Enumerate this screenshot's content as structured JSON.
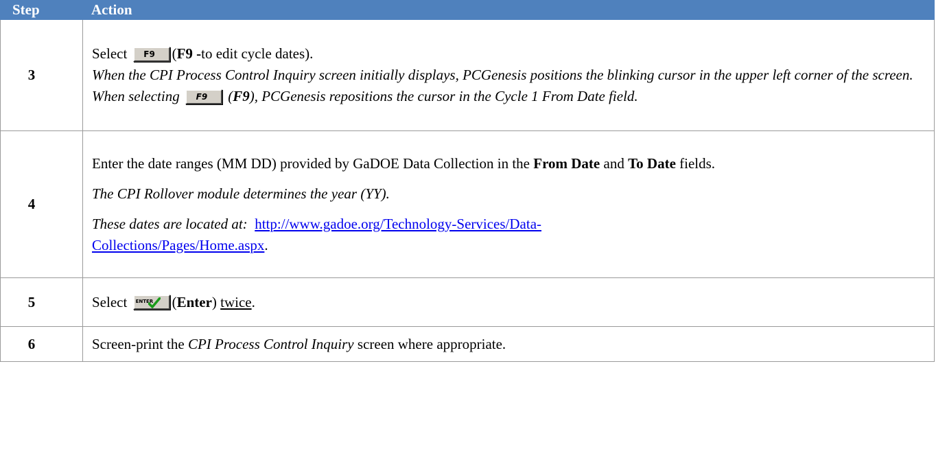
{
  "header": {
    "step": "Step",
    "action": "Action"
  },
  "rows": [
    {
      "step": "3",
      "select_prefix": "Select",
      "f9_button": "F9",
      "f9_desc_open": "(",
      "f9_desc_bold": "F9 -",
      "f9_desc_rest": "to edit cycle dates).",
      "note_part1": "When the CPI Process Control Inquiry screen initially displays, PCGenesis positions the blinking cursor in the upper left corner of the screen. When selecting",
      "note_f9_button": "F9",
      "note_f9_open": "(",
      "note_f9_bold": "F9",
      "note_f9_close": "),",
      "note_part2": "PCGenesis repositions the cursor in the Cycle 1 From Date field."
    },
    {
      "step": "4",
      "line1_a": "Enter the date ranges (MM DD) provided by GaDOE Data Collection in the",
      "line1_bold1": "From Date",
      "line1_b": "and",
      "line1_bold2": "To Date",
      "line1_c": "fields.",
      "note1": "The CPI Rollover module determines the year (YY).",
      "note2": "These dates are located at:",
      "link": "http://www.gadoe.org/Technology-Services/Data-Collections/Pages/Home.aspx",
      "link_line1": "http://www.gadoe.org/Technology-Services/Data-",
      "link_line2": "Collections/Pages/Home.aspx",
      "after_link": "."
    },
    {
      "step": "5",
      "select_prefix": "Select",
      "enter_button": "ENTER",
      "open": "(",
      "bold": "Enter",
      "close": ")",
      "twice": "twice",
      "end": "."
    },
    {
      "step": "6",
      "text_a": "Screen-print the",
      "text_it": "CPI Process Control Inquiry",
      "text_b": "screen where appropriate."
    }
  ],
  "colors": {
    "header_bg": "#4f81bd",
    "header_text": "#ffffff",
    "link": "#0000ee",
    "border": "#9a9a9a"
  },
  "icons": {
    "f9_button": "f9-key-button-icon",
    "enter_button": "enter-check-button-icon"
  }
}
